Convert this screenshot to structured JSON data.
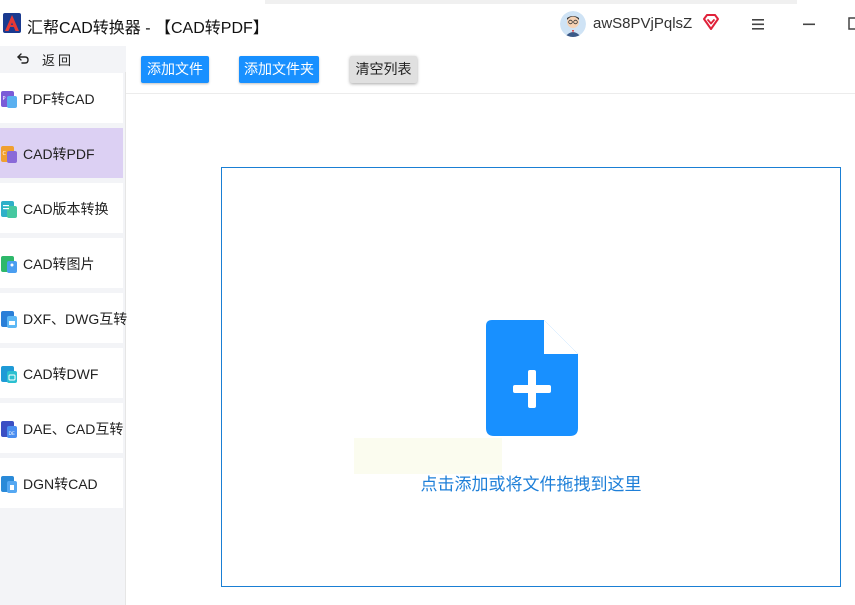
{
  "app": {
    "title": "汇帮CAD转换器 - 【CAD转PDF】",
    "username": "awS8PVjPqlsZ"
  },
  "window_controls": [
    "menu-icon",
    "minimize-icon",
    "maximize-icon"
  ],
  "sidebar": {
    "back_label": "返回",
    "items": [
      {
        "label": "PDF转CAD",
        "icon": "pdf-to-cad-icon",
        "active": false
      },
      {
        "label": "CAD转PDF",
        "icon": "cad-to-pdf-icon",
        "active": true
      },
      {
        "label": "CAD版本转换",
        "icon": "cad-version-icon",
        "active": false
      },
      {
        "label": "CAD转图片",
        "icon": "cad-to-image-icon",
        "active": false
      },
      {
        "label": "DXF、DWG互转",
        "icon": "dxf-dwg-icon",
        "active": false
      },
      {
        "label": "CAD转DWF",
        "icon": "cad-to-dwf-icon",
        "active": false
      },
      {
        "label": "DAE、CAD互转",
        "icon": "dae-cad-icon",
        "active": false
      },
      {
        "label": "DGN转CAD",
        "icon": "dgn-to-cad-icon",
        "active": false
      }
    ]
  },
  "toolbar": {
    "add_file": "添加文件",
    "add_folder": "添加文件夹",
    "clear_list": "清空列表"
  },
  "dropzone": {
    "hint": "点击添加或将文件拖拽到这里"
  },
  "colors": {
    "accent": "#1890ff",
    "active_item": "#dcd0f3",
    "dropzone_border": "#1a7fd4",
    "logo_red": "#d9232e"
  }
}
